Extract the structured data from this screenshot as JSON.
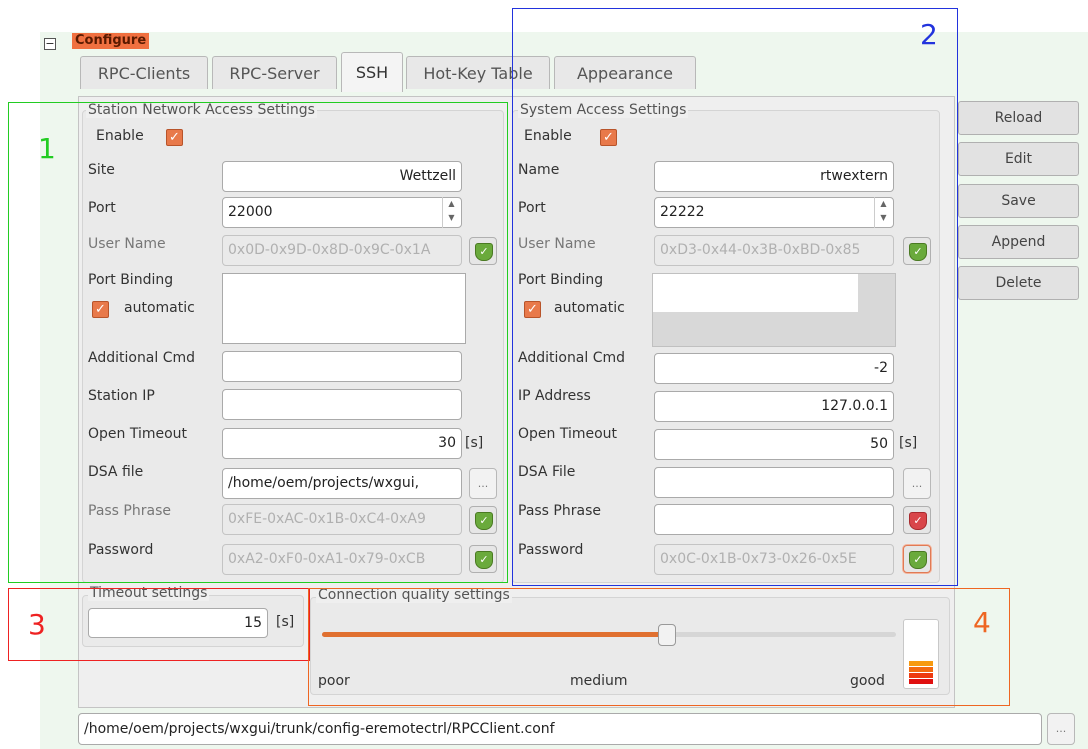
{
  "tree": {
    "node_label": "Configure",
    "expander": "−"
  },
  "tabs": [
    {
      "label": "RPC-Clients"
    },
    {
      "label": "RPC-Server"
    },
    {
      "label": "SSH"
    },
    {
      "label": "Hot-Key Table"
    },
    {
      "label": "Appearance"
    }
  ],
  "station": {
    "title": "Station Network Access Settings",
    "enable_label": "Enable",
    "site_label": "Site",
    "site_value": "Wettzell",
    "port_label": "Port",
    "port_value": "22000",
    "user_label": "User Name",
    "user_value": "0x0D-0x9D-0x8D-0x9C-0x1A",
    "binding_label": "Port Binding",
    "automatic_label": "automatic",
    "cmd_label": "Additional Cmd",
    "cmd_value": "",
    "ip_label": "Station IP",
    "ip_value": "",
    "timeout_label": "Open Timeout",
    "timeout_value": "30",
    "timeout_unit": "[s]",
    "dsa_label": "DSA file",
    "dsa_value": "/home/oem/projects/wxgui,",
    "dsa_button": "...",
    "pass_label": "Pass Phrase",
    "pass_value": "0xFE-0xAC-0x1B-0xC4-0xA9",
    "pw_label": "Password",
    "pw_value": "0xA2-0xF0-0xA1-0x79-0xCB"
  },
  "system": {
    "title": "System Access Settings",
    "enable_label": "Enable",
    "name_label": "Name",
    "name_value": "rtwextern",
    "port_label": "Port",
    "port_value": "22222",
    "user_label": "User Name",
    "user_value": "0xD3-0x44-0x3B-0xBD-0x85",
    "binding_label": "Port Binding",
    "automatic_label": "automatic",
    "cmd_label": "Additional Cmd",
    "cmd_value": "-2",
    "ip_label": "IP Address",
    "ip_value": "127.0.0.1",
    "timeout_label": "Open Timeout",
    "timeout_value": "50",
    "timeout_unit": "[s]",
    "dsa_label": "DSA File",
    "dsa_value": "",
    "dsa_button": "...",
    "pass_label": "Pass Phrase",
    "pass_value": "",
    "pw_label": "Password",
    "pw_value": "0x0C-0x1B-0x73-0x26-0x5E"
  },
  "side_buttons": [
    "Reload",
    "Edit",
    "Save",
    "Append",
    "Delete"
  ],
  "timeout_settings": {
    "title": "Timeout settings",
    "value": "15",
    "unit": "[s]"
  },
  "quality": {
    "title": "Connection quality settings",
    "poor": "poor",
    "medium": "medium",
    "good": "good",
    "slider_fraction": 0.6,
    "meter_level_fraction": 0.45
  },
  "config_path": {
    "value": "/home/oem/projects/wxgui/trunk/config-eremotectrl/RPCClient.conf",
    "button": "..."
  },
  "annotations": [
    {
      "number": "1",
      "color": "#22cc22"
    },
    {
      "number": "2",
      "color": "#2233dd"
    },
    {
      "number": "3",
      "color": "#ee2222"
    },
    {
      "number": "4",
      "color": "#ee6622"
    }
  ],
  "colors": {
    "accent": "#e8794a",
    "ok": "#6aaa3c",
    "error": "#d9464a"
  }
}
